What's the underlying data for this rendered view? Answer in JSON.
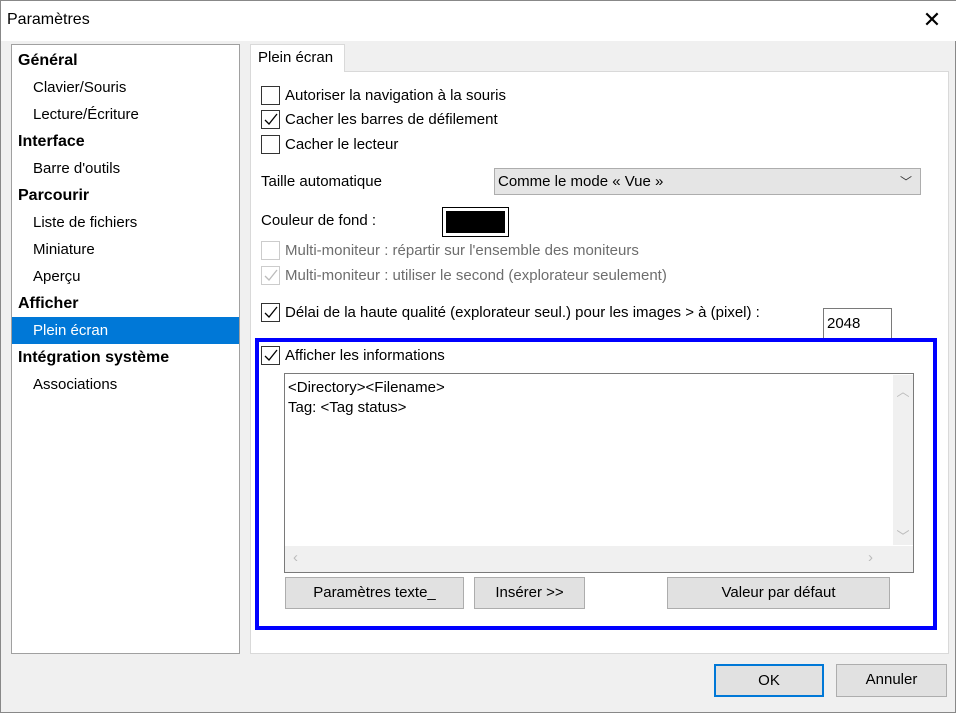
{
  "window": {
    "title": "Paramètres",
    "close_icon": "close-icon"
  },
  "sidebar": {
    "items": [
      {
        "label": "Général",
        "type": "category"
      },
      {
        "label": "Clavier/Souris",
        "type": "sub"
      },
      {
        "label": "Lecture/Écriture",
        "type": "sub"
      },
      {
        "label": "Interface",
        "type": "category"
      },
      {
        "label": "Barre d'outils",
        "type": "sub"
      },
      {
        "label": "Parcourir",
        "type": "category"
      },
      {
        "label": "Liste de fichiers",
        "type": "sub"
      },
      {
        "label": "Miniature",
        "type": "sub"
      },
      {
        "label": "Aperçu",
        "type": "sub"
      },
      {
        "label": "Afficher",
        "type": "category"
      },
      {
        "label": "Plein écran",
        "type": "sub",
        "selected": true
      },
      {
        "label": "Intégration système",
        "type": "category"
      },
      {
        "label": "Associations",
        "type": "sub"
      }
    ]
  },
  "tab": {
    "label": "Plein écran"
  },
  "options": {
    "mouse_nav": {
      "label": "Autoriser la navigation à la souris",
      "checked": false
    },
    "hide_scrollbars": {
      "label": "Cacher les barres de défilement",
      "checked": true
    },
    "hide_player": {
      "label": "Cacher le lecteur",
      "checked": false
    },
    "auto_size_label": "Taille automatique",
    "auto_size_value": "Comme le mode « Vue »",
    "bg_color_label": "Couleur de fond :",
    "bg_color": "#000000",
    "multi_spread": {
      "label": "Multi-moniteur : répartir sur l'ensemble des moniteurs",
      "checked": false,
      "disabled": true
    },
    "multi_second": {
      "label": "Multi-moniteur : utiliser le second (explorateur seulement)",
      "checked": true,
      "disabled": true
    },
    "hq_delay": {
      "label": "Délai de la haute qualité (explorateur seul.) pour les images > à (pixel) :",
      "checked": true,
      "value": "2048"
    },
    "show_info": {
      "label": "Afficher les informations",
      "checked": true
    },
    "info_text": "<Directory><Filename>\nTag: <Tag status>",
    "text_settings_button": "Paramètres texte_",
    "insert_button": "Insérer >>",
    "default_button": "Valeur par défaut"
  },
  "footer": {
    "ok": "OK",
    "cancel": "Annuler"
  },
  "colors": {
    "accent": "#0078d7",
    "highlight": "#0000ff"
  }
}
